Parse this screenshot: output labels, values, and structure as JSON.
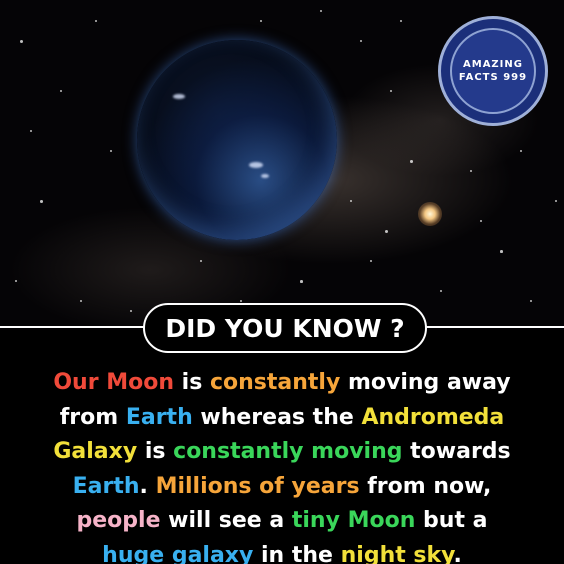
{
  "logo": {
    "line1": "AMAZING",
    "line2": "FACTS 999"
  },
  "badge": {
    "label": "DID YOU KNOW ?"
  },
  "colors": {
    "red": "#f04a3a",
    "orange": "#f6a53a",
    "white": "#ffffff",
    "blue": "#39b0f0",
    "yellow": "#f2e03a",
    "green": "#3ad65a",
    "pink": "#f6b3c8"
  },
  "fact": {
    "lines": [
      [
        {
          "text": "Our Moon",
          "color": "#f04a3a"
        },
        {
          "text": " is ",
          "color": "#ffffff"
        },
        {
          "text": "constantly",
          "color": "#f6a53a"
        },
        {
          "text": " moving away",
          "color": "#ffffff"
        }
      ],
      [
        {
          "text": "from ",
          "color": "#ffffff"
        },
        {
          "text": "Earth",
          "color": "#39b0f0"
        },
        {
          "text": " whereas the ",
          "color": "#ffffff"
        },
        {
          "text": "Andromeda",
          "color": "#f2e03a"
        }
      ],
      [
        {
          "text": "Galaxy",
          "color": "#f2e03a"
        },
        {
          "text": " is ",
          "color": "#ffffff"
        },
        {
          "text": "constantly moving",
          "color": "#3ad65a"
        },
        {
          "text": " towards",
          "color": "#ffffff"
        }
      ],
      [
        {
          "text": "Earth",
          "color": "#39b0f0"
        },
        {
          "text": ". ",
          "color": "#ffffff"
        },
        {
          "text": "Millions of years",
          "color": "#f6a53a"
        },
        {
          "text": " from now,",
          "color": "#ffffff"
        }
      ],
      [
        {
          "text": "people",
          "color": "#f6b3c8"
        },
        {
          "text": " will see a ",
          "color": "#ffffff"
        },
        {
          "text": "tiny Moon",
          "color": "#3ad65a"
        },
        {
          "text": " but a",
          "color": "#ffffff"
        }
      ],
      [
        {
          "text": "huge galaxy",
          "color": "#39b0f0"
        },
        {
          "text": " in the ",
          "color": "#ffffff"
        },
        {
          "text": "night sky",
          "color": "#f2e03a"
        },
        {
          "text": ".",
          "color": "#ffffff"
        }
      ]
    ]
  }
}
